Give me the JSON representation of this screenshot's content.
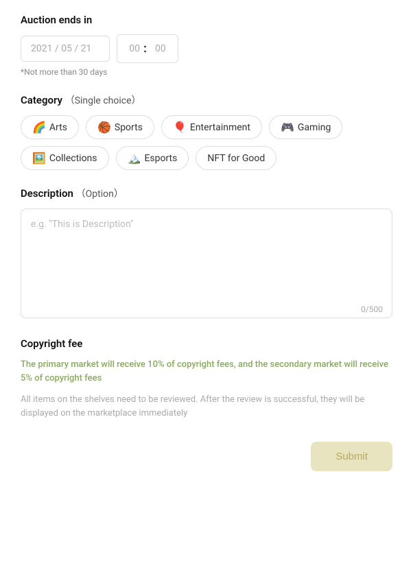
{
  "auction": {
    "label": "Auction ends in",
    "date_placeholder": "2021 / 05 / 21",
    "hour_placeholder": "00",
    "minute_placeholder": "00",
    "hint": "*Not more than 30 days"
  },
  "category": {
    "label": "Category",
    "sublabel": "（Single choice）",
    "chips": [
      {
        "id": "arts",
        "emoji": "🌈",
        "label": "Arts"
      },
      {
        "id": "sports",
        "emoji": "🏀",
        "label": "Sports"
      },
      {
        "id": "entertainment",
        "emoji": "🎈",
        "label": "Entertainment"
      },
      {
        "id": "gaming",
        "emoji": "🎮",
        "label": "Gaming"
      },
      {
        "id": "collections",
        "emoji": "🖼️",
        "label": "Collections"
      },
      {
        "id": "esports",
        "emoji": "🏔️",
        "label": "Esports"
      },
      {
        "id": "nftforgood",
        "emoji": "",
        "label": "NFT for Good"
      }
    ]
  },
  "description": {
    "label": "Description",
    "sublabel": "（Option）",
    "placeholder": "e.g. \"This is Description\"",
    "char_count": "0/500"
  },
  "copyright": {
    "label": "Copyright fee",
    "primary_text": "The primary market will receive 10% of copyright fees, and the secondary market will receive 5% of copyright fees",
    "secondary_text": "All items on the shelves need to be reviewed. After the review is successful, they will be displayed on the marketplace immediately"
  },
  "submit": {
    "label": "Submit"
  }
}
